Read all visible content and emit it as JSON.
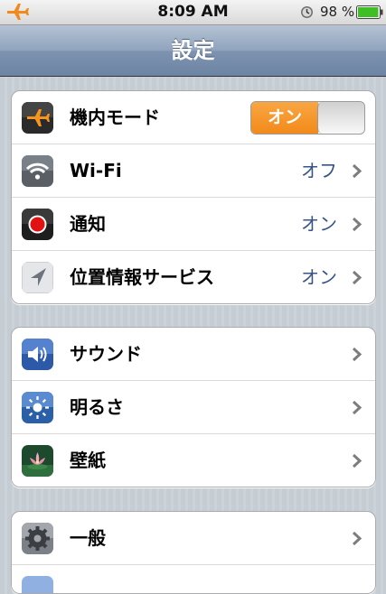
{
  "status_bar": {
    "time": "8:09 AM",
    "battery_text": "98 %",
    "battery_level": 0.98
  },
  "nav": {
    "title": "設定"
  },
  "groups": [
    {
      "rows": [
        {
          "icon": "airplane-icon",
          "label": "機内モード",
          "toggle_label": "オン",
          "toggle_on": true
        },
        {
          "icon": "wifi-icon",
          "label": "Wi-Fi",
          "value": "オフ"
        },
        {
          "icon": "notifications-icon",
          "label": "通知",
          "value": "オン"
        },
        {
          "icon": "location-icon",
          "label": "位置情報サービス",
          "value": "オン"
        }
      ]
    },
    {
      "rows": [
        {
          "icon": "sound-icon",
          "label": "サウンド"
        },
        {
          "icon": "brightness-icon",
          "label": "明るさ"
        },
        {
          "icon": "wallpaper-icon",
          "label": "壁紙"
        }
      ]
    },
    {
      "rows": [
        {
          "icon": "gear-icon",
          "label": "一般"
        }
      ]
    }
  ],
  "colors": {
    "toggle_on": "#f28a1a",
    "value_text": "#385487",
    "nav_bar": "#7d93b0"
  }
}
